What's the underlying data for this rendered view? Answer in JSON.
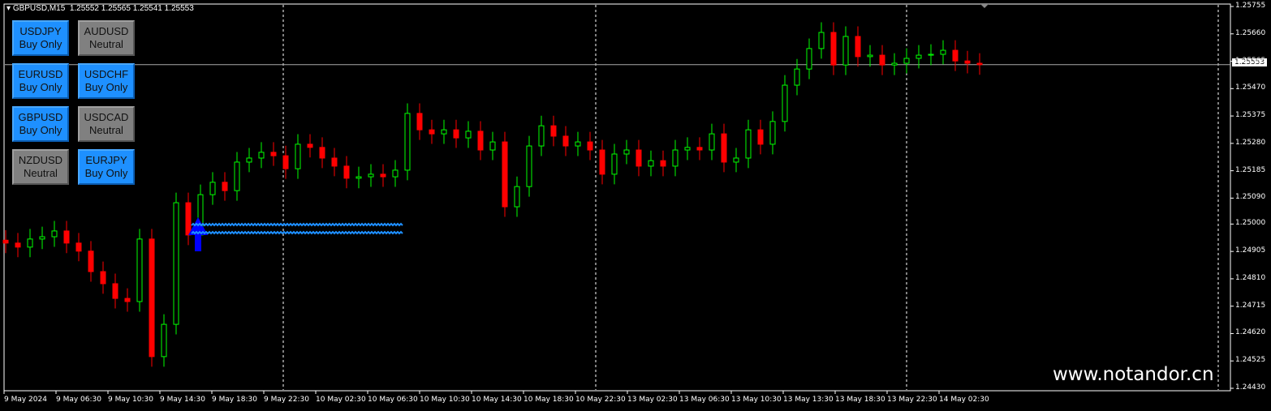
{
  "header": {
    "symbol": "GBPUSD,M15",
    "ohlc": "1.25552 1.25565 1.25541 1.25553"
  },
  "panel": [
    {
      "symbol": "USDJPY",
      "state": "Buy Only",
      "color": "blue"
    },
    {
      "symbol": "AUDUSD",
      "state": "Neutral",
      "color": "gray"
    },
    {
      "symbol": "EURUSD",
      "state": "Buy Only",
      "color": "blue"
    },
    {
      "symbol": "USDCHF",
      "state": "Buy Only",
      "color": "blue"
    },
    {
      "symbol": "GBPUSD",
      "state": "Buy Only",
      "color": "blue"
    },
    {
      "symbol": "USDCAD",
      "state": "Neutral",
      "color": "gray"
    },
    {
      "symbol": "NZDUSD",
      "state": "Neutral",
      "color": "gray"
    },
    {
      "symbol": "EURJPY",
      "state": "Buy Only",
      "color": "blue"
    }
  ],
  "watermark": "www.notandor.cn",
  "chart_data": {
    "type": "candlestick",
    "symbol": "GBPUSD",
    "timeframe": "M15",
    "ylim": [
      1.2443,
      1.25755
    ],
    "price_ticks": [
      "1.25755",
      "1.25660",
      "1.25565",
      "1.25470",
      "1.25375",
      "1.25280",
      "1.25185",
      "1.25090",
      "1.25000",
      "1.24905",
      "1.24810",
      "1.24715",
      "1.24620",
      "1.24525",
      "1.24430"
    ],
    "bid": "1.25553",
    "time_ticks": [
      "9 May 2024",
      "9 May 06:30",
      "9 May 10:30",
      "9 May 14:30",
      "9 May 18:30",
      "9 May 22:30",
      "10 May 02:30",
      "10 May 06:30",
      "10 May 10:30",
      "10 May 14:30",
      "10 May 18:30",
      "10 May 22:30",
      "13 May 02:30",
      "13 May 06:30",
      "13 May 10:30",
      "13 May 13:30",
      "13 May 18:30",
      "13 May 22:30",
      "14 May 02:30"
    ],
    "closes": [
      1.24934,
      1.2492,
      1.24948,
      1.24956,
      1.24976,
      1.24934,
      1.24906,
      1.24835,
      1.24793,
      1.24742,
      1.24731,
      1.24948,
      1.2454,
      1.24652,
      1.25074,
      1.24962,
      1.25102,
      1.25145,
      1.25116,
      1.25215,
      1.25229,
      1.25249,
      1.25237,
      1.25192,
      1.25277,
      1.25266,
      1.25229,
      1.25201,
      1.25159,
      1.25164,
      1.25173,
      1.25164,
      1.25187,
      1.25384,
      1.25327,
      1.25313,
      1.25327,
      1.25299,
      1.25322,
      1.25257,
      1.25285,
      1.2506,
      1.2513,
      1.25271,
      1.25341,
      1.25305,
      1.25271,
      1.25285,
      1.25257,
      1.25173,
      1.25243,
      1.25257,
      1.25201,
      1.2522,
      1.25201,
      1.25257,
      1.25266,
      1.25257,
      1.25313,
      1.25215,
      1.25229,
      1.25327,
      1.25277,
      1.25356,
      1.25482,
      1.25538,
      1.25609,
      1.25665,
      1.25552,
      1.25651,
      1.25581,
      1.25586,
      1.25552,
      1.25558,
      1.25575,
      1.25586,
      1.25589,
      1.25603,
      1.25566,
      1.25558,
      1.25553
    ],
    "bull_color": "#00ff00",
    "bear_color": "#ff0000",
    "signal_color": "#1e90ff",
    "grid": false
  }
}
